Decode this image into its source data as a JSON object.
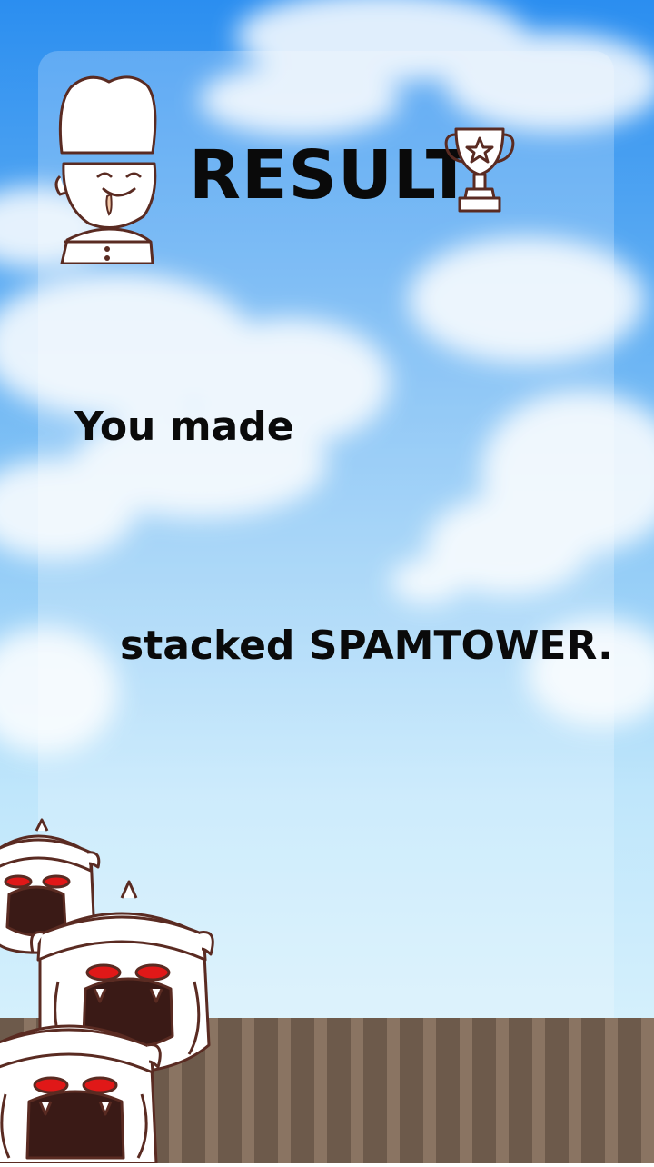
{
  "result": {
    "title": "RESULT",
    "line1": "You made",
    "line2": "stacked SPAMTOWER."
  },
  "icons": {
    "chef": "chef-mascot-icon",
    "trophy": "trophy-icon",
    "monsters": "helmet-monster-icon"
  },
  "colors": {
    "sky_top": "#2b8ef0",
    "sky_bottom": "#e2f6fd",
    "floor": "#6d5a4b",
    "text": "#0a0a0a",
    "monster_eye": "#e01818"
  }
}
